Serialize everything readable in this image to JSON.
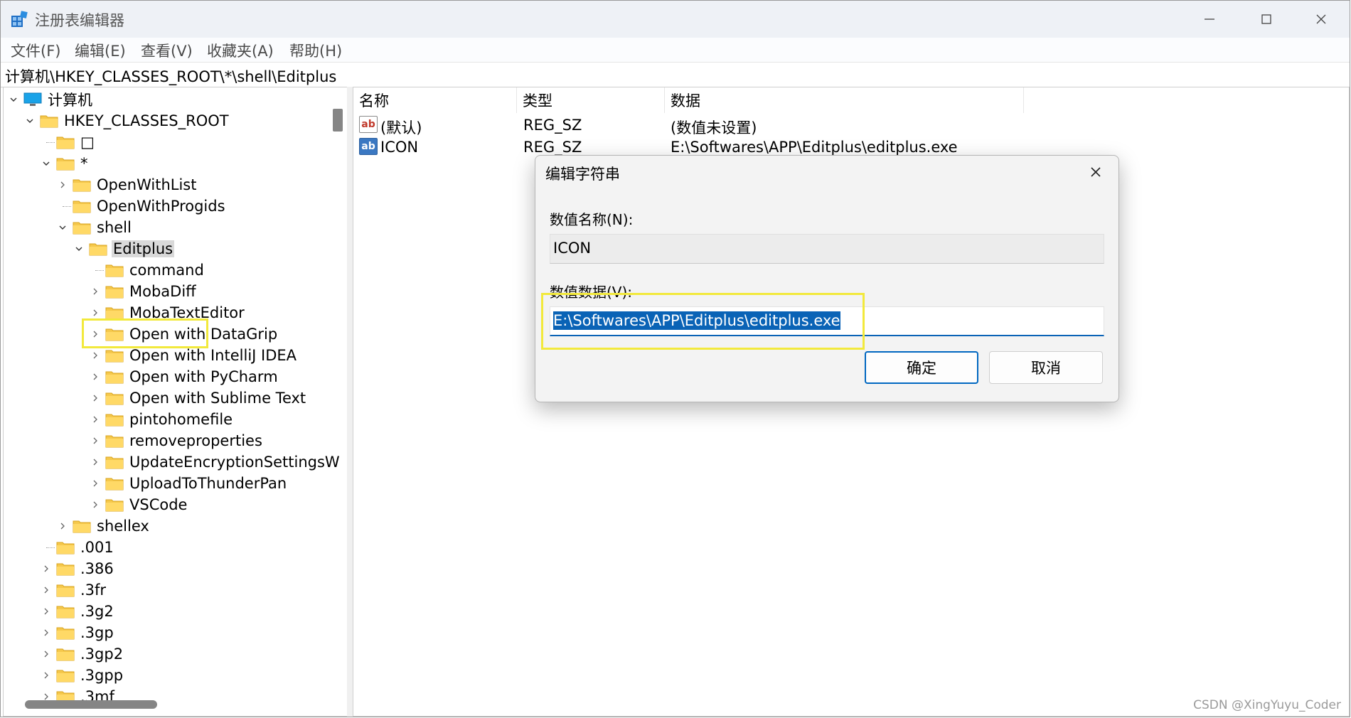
{
  "window": {
    "title": "注册表编辑器"
  },
  "menu": [
    "文件(F)",
    "编辑(E)",
    "查看(V)",
    "收藏夹(A)",
    "帮助(H)"
  ],
  "address": "计算机\\HKEY_CLASSES_ROOT\\*\\shell\\Editplus",
  "tree": [
    {
      "label": "计算机",
      "expanded": true
    },
    {
      "label": "HKEY_CLASSES_ROOT",
      "expanded": true
    },
    {
      "label": "□"
    },
    {
      "label": "*",
      "expanded": true
    },
    {
      "label": "OpenWithList"
    },
    {
      "label": "OpenWithProgids"
    },
    {
      "label": "shell",
      "expanded": true
    },
    {
      "label": "Editplus",
      "expanded": true,
      "selected": true
    },
    {
      "label": "command"
    },
    {
      "label": "MobaDiff"
    },
    {
      "label": "MobaTextEditor"
    },
    {
      "label": "Open with DataGrip"
    },
    {
      "label": "Open with IntelliJ IDEA"
    },
    {
      "label": "Open with PyCharm"
    },
    {
      "label": "Open with Sublime Text"
    },
    {
      "label": "pintohomefile"
    },
    {
      "label": "removeproperties"
    },
    {
      "label": "UpdateEncryptionSettingsW"
    },
    {
      "label": "UploadToThunderPan"
    },
    {
      "label": "VSCode"
    },
    {
      "label": "shellex"
    },
    {
      "label": ".001"
    },
    {
      "label": ".386"
    },
    {
      "label": ".3fr"
    },
    {
      "label": ".3g2"
    },
    {
      "label": ".3gp"
    },
    {
      "label": ".3gp2"
    },
    {
      "label": ".3gpp"
    },
    {
      "label": ".3mf"
    }
  ],
  "list": {
    "columns": [
      "名称",
      "类型",
      "数据"
    ],
    "rows": [
      {
        "name": "(默认)",
        "type": "REG_SZ",
        "data": "(数值未设置)"
      },
      {
        "name": "ICON",
        "type": "REG_SZ",
        "data": "E:\\Softwares\\APP\\Editplus\\editplus.exe"
      }
    ],
    "icon_text": "ab"
  },
  "dialog": {
    "title": "编辑字符串",
    "name_label": "数值名称(N):",
    "name_value": "ICON",
    "data_label": "数值数据(V):",
    "data_value": "E:\\Softwares\\APP\\Editplus\\editplus.exe",
    "ok": "确定",
    "cancel": "取消"
  },
  "watermark": "CSDN @XingYuyu_Coder",
  "colors": {
    "highlight_box": "#f2e93c",
    "selection": "#0a63b6",
    "folder": "#f5c84c"
  }
}
